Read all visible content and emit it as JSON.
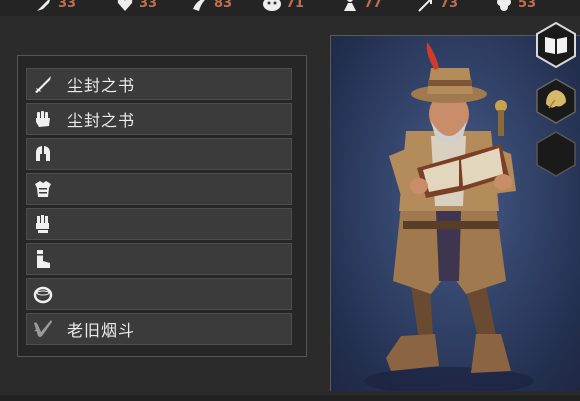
{
  "stats": [
    {
      "icon": "sword-stat-icon",
      "value": "33"
    },
    {
      "icon": "heart-stat-icon",
      "value": "33"
    },
    {
      "icon": "claw-stat-icon",
      "value": "83"
    },
    {
      "icon": "beast-stat-icon",
      "value": "71"
    },
    {
      "icon": "figure-stat-icon",
      "value": "77"
    },
    {
      "icon": "arrow-stat-icon",
      "value": "73"
    },
    {
      "icon": "clover-stat-icon",
      "value": "53"
    }
  ],
  "equipment": {
    "slots": [
      {
        "icon": "sword-icon",
        "label": "尘封之书"
      },
      {
        "icon": "fist-icon",
        "label": "尘封之书"
      },
      {
        "icon": "helmet-icon",
        "label": ""
      },
      {
        "icon": "chest-armor-icon",
        "label": ""
      },
      {
        "icon": "glove-icon",
        "label": ""
      },
      {
        "icon": "boot-icon",
        "label": ""
      },
      {
        "icon": "ring-icon",
        "label": ""
      },
      {
        "icon": "pipe-icon",
        "label": "老旧烟斗"
      }
    ]
  },
  "tabs": [
    {
      "icon": "book-tab-icon",
      "active": true
    },
    {
      "icon": "leaf-tab-icon",
      "active": false
    },
    {
      "icon": "empty-tab-icon",
      "active": false
    }
  ],
  "colors": {
    "stat_value": "#c06f4e",
    "slot_bg": "#3b3b3b",
    "preview_bg": "#34456c"
  }
}
